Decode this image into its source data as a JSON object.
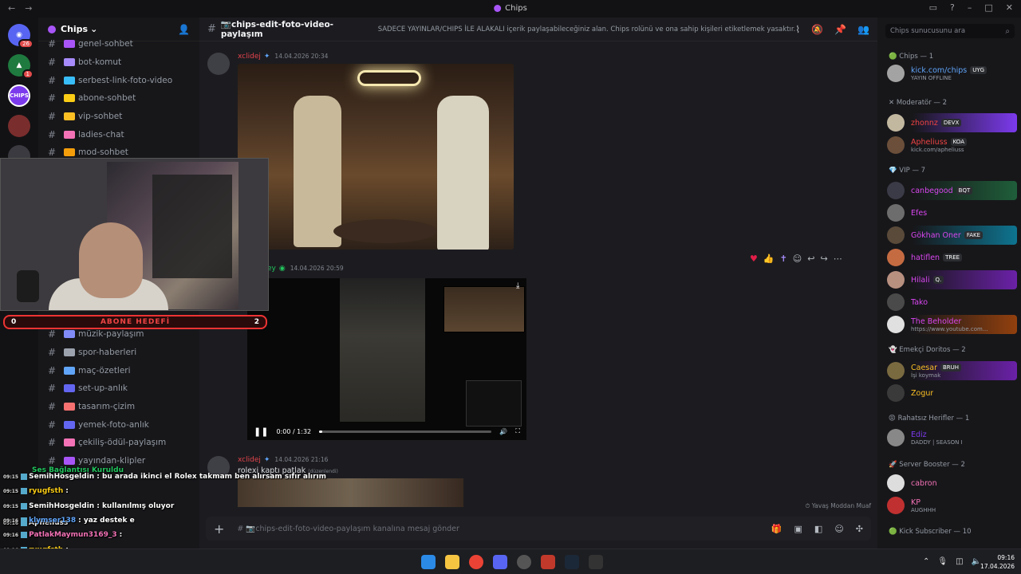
{
  "window": {
    "title": "Chips"
  },
  "rail": {
    "badges": [
      "26",
      "1"
    ],
    "server_label": "CHIPS"
  },
  "server": {
    "name": "Chips"
  },
  "channels_top": [
    {
      "name": "genel-sohbet",
      "color": "#a855f7"
    },
    {
      "name": "bot-komut",
      "color": "#a78bfa"
    },
    {
      "name": "serbest-link-foto-video",
      "color": "#38bdf8"
    },
    {
      "name": "abone-sohbet",
      "color": "#facc15"
    },
    {
      "name": "vip-sohbet",
      "color": "#fbbf24"
    },
    {
      "name": "ladies-chat",
      "color": "#f472b6"
    },
    {
      "name": "mod-sohbet",
      "color": "#f59e0b"
    }
  ],
  "channels_bottom": [
    {
      "name": "müzik-paylaşım",
      "color": "#818cf8"
    },
    {
      "name": "spor-haberleri",
      "color": "#9ca3af"
    },
    {
      "name": "maç-özetleri",
      "color": "#60a5fa"
    },
    {
      "name": "set-up-anlık",
      "color": "#6366f1"
    },
    {
      "name": "tasarım-çizim",
      "color": "#f87171"
    },
    {
      "name": "yemek-foto-anlık",
      "color": "#6366f1"
    },
    {
      "name": "çekiliş-ödül-paylaşım",
      "color": "#f472b6"
    },
    {
      "name": "yayından-klipler",
      "color": "#a855f7"
    }
  ],
  "webcam": {
    "goal_left": "0",
    "goal_label": "ABONE HEDEFİ",
    "goal_right": "2"
  },
  "channel": {
    "name": "📷chips-edit-foto-video-paylaşım",
    "topic": "SADECE YAYINLAR/CHIPS İLE ALAKALI içerik paylaşabileceğiniz alan. Chips rolünü ve ona sahip kişileri etiketlemek yasaktır."
  },
  "messages": [
    {
      "author": "xclidej",
      "timestamp": "14.04.2026 20:34"
    },
    {
      "author": "ey",
      "timestamp": "14.04.2026 20:59",
      "video_time": "0:00 / 1:32",
      "video_progress": 0.02
    },
    {
      "author": "xclidej",
      "timestamp": "14.04.2026 21:16",
      "text": "rolexi kaptı patlak",
      "edited": "(düzenlendi)"
    }
  ],
  "slowmode": "Yavaş Moddan Muaf",
  "composer": {
    "placeholder": "# 📷chips-edit-foto-video-paylaşım kanalına mesaj gönder"
  },
  "member_search": {
    "placeholder": "Chips sunucusunu ara"
  },
  "member_groups": [
    {
      "label": "Chips — 1"
    },
    {
      "label": "Moderatör — 2"
    },
    {
      "label": "VIP — 7"
    },
    {
      "label": "Emekçi Doritos — 2"
    },
    {
      "label": "Rahatsız Herifler — 1"
    },
    {
      "label": "Server Booster — 2"
    },
    {
      "label": "Kick Subscriber — 10"
    }
  ],
  "members": [
    {
      "name": "kick.com/chips",
      "tag": "UYG",
      "sub": "YAYIN OFFLINE",
      "color": "#60a5fa"
    },
    {
      "name": "zhonnz",
      "tag": "DEVX",
      "sub": "",
      "color": "#ef4444"
    },
    {
      "name": "Apheliuss",
      "tag": "KOA",
      "sub": "kick.com/apheliuss",
      "color": "#ef4444"
    },
    {
      "name": "canbegood",
      "tag": "BQT",
      "sub": "",
      "color": "#d946ef"
    },
    {
      "name": "Efes",
      "tag": "",
      "sub": "",
      "color": "#d946ef"
    },
    {
      "name": "Gökhan Öner",
      "tag": "FAKE",
      "sub": "",
      "color": "#d946ef"
    },
    {
      "name": "hatiflen",
      "tag": "TREE",
      "sub": "",
      "color": "#d946ef"
    },
    {
      "name": "Hilali",
      "tag": "Q.",
      "sub": "",
      "color": "#d946ef"
    },
    {
      "name": "Tako",
      "tag": "",
      "sub": "",
      "color": "#d946ef"
    },
    {
      "name": "The Beholder",
      "tag": "",
      "sub": "https://www.youtube.com...",
      "color": "#d946ef"
    },
    {
      "name": "Caesar",
      "tag": "BRUH",
      "sub": "İşi koymak",
      "color": "#fbbf24"
    },
    {
      "name": "Zogur",
      "tag": "",
      "sub": "",
      "color": "#fbbf24"
    },
    {
      "name": "Ediz",
      "tag": "",
      "sub": "DADDY | SEASON I",
      "color": "#7c3aed"
    },
    {
      "name": "cabron",
      "tag": "",
      "sub": "",
      "color": "#f472b6"
    },
    {
      "name": "KP",
      "tag": "",
      "sub": "AUGHHH",
      "color": "#f472b6"
    }
  ],
  "stream_chat": [
    {
      "time": "09:16",
      "user": "",
      "text": "Ses Bağlantısı Kuruldu",
      "color": "#22c55e"
    },
    {
      "time": "09:15",
      "user": "SemihHosgeldin",
      "text": ": bu arada ikinci el Rolex takmam ben alırsam sıfır alırım",
      "color": "#fff"
    },
    {
      "time": "09:15",
      "user": "ryugfsth",
      "text": ":",
      "color": "#facc15"
    },
    {
      "time": "09:15",
      "user": "SemihHosgeldin",
      "text": ": kullanılmış oluyor",
      "color": "#fff"
    },
    {
      "time": "09:16",
      "user": "Apheliuss",
      "text": "",
      "color": "#fff"
    },
    {
      "time": "09:16",
      "user": "klymser138",
      "text": ": yaz destek e",
      "color": "#60a5fa"
    },
    {
      "time": "09:16",
      "user": "PatlakMaymun3169_3",
      "text": ":",
      "color": "#f472b6"
    },
    {
      "time": "09:16",
      "user": "ryugfsth",
      "text": ":",
      "color": "#facc15"
    },
    {
      "time": "09:16",
      "user": "PatlakMaymun3169_3",
      "text": ":",
      "color": "#f472b6"
    }
  ],
  "taskbar": {
    "time": "09:16",
    "date": "17.04.2026"
  }
}
